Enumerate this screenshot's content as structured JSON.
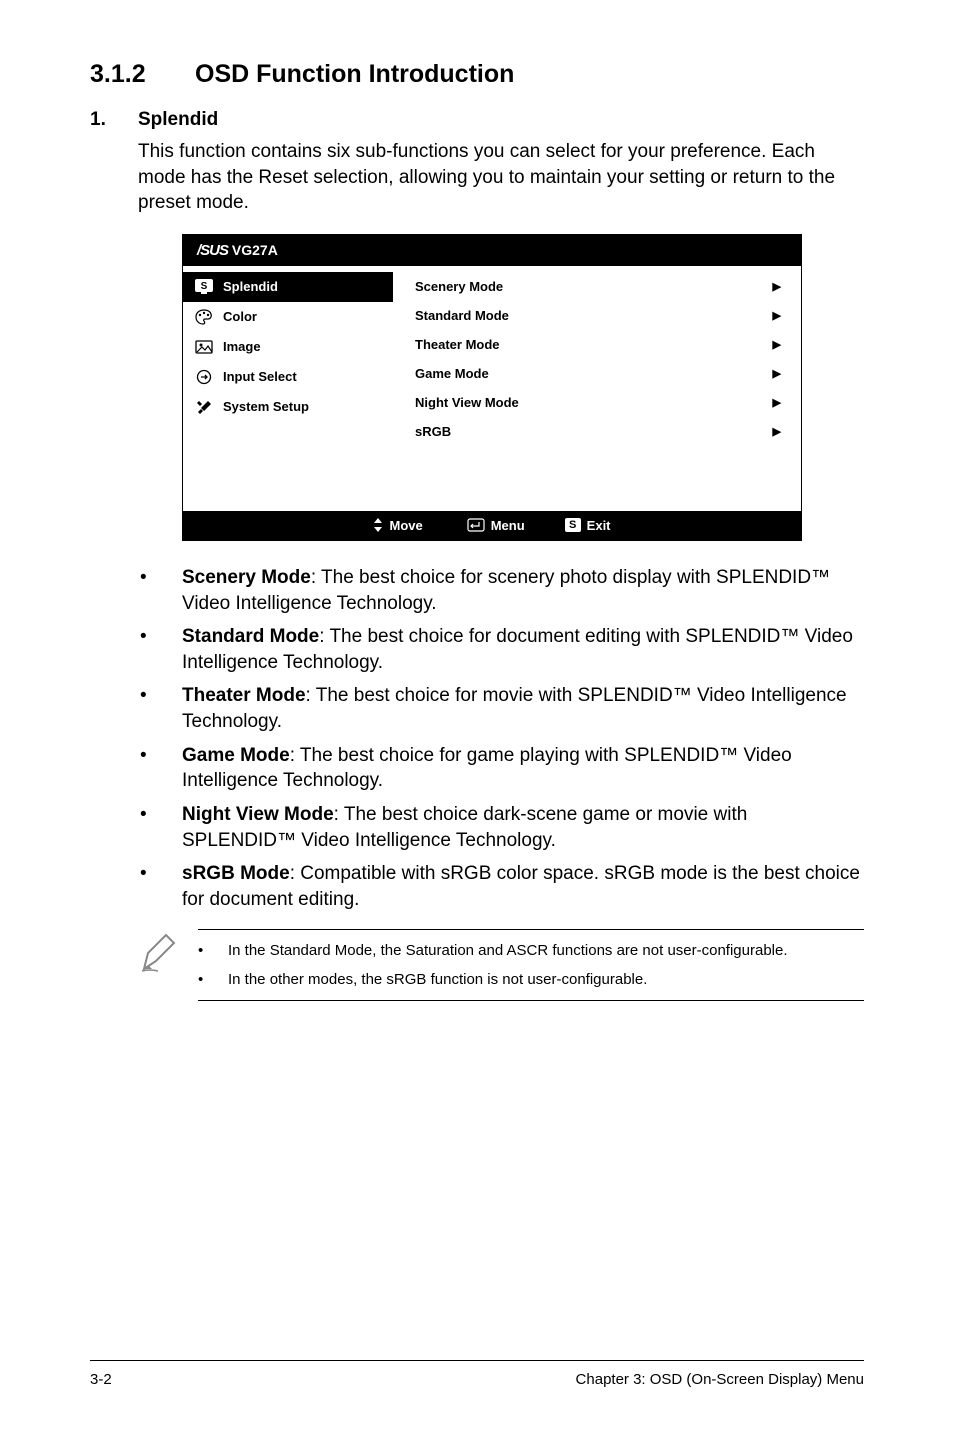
{
  "heading": {
    "num": "3.1.2",
    "title": "OSD Function Introduction"
  },
  "section": {
    "num": "1.",
    "title": "Splendid"
  },
  "intro": "This function contains six sub-functions you can select for your preference. Each mode has the Reset selection, allowing you to maintain your setting or return to the preset mode.",
  "osd": {
    "brand": "/SUS",
    "model": "VG27A",
    "left": [
      {
        "label": "Splendid",
        "icon": "s-monitor"
      },
      {
        "label": "Color",
        "icon": "palette"
      },
      {
        "label": "Image",
        "icon": "image"
      },
      {
        "label": "Input Select",
        "icon": "input"
      },
      {
        "label": "System Setup",
        "icon": "tools"
      }
    ],
    "right": [
      "Scenery Mode",
      "Standard Mode",
      "Theater Mode",
      "Game Mode",
      "Night View Mode",
      "sRGB"
    ],
    "footer": {
      "move": "Move",
      "menu": "Menu",
      "exit": "Exit"
    }
  },
  "bullets": [
    {
      "title": "Scenery Mode",
      "desc": ": The best choice for scenery photo display with SPLENDID™  Video Intelligence Technology."
    },
    {
      "title": "Standard Mode",
      "desc": ": The best choice for document editing with SPLENDID™ Video Intelligence Technology."
    },
    {
      "title": "Theater Mode",
      "desc": ": The best choice for movie with SPLENDID™ Video Intelligence Technology."
    },
    {
      "title": "Game Mode",
      "desc": ": The best choice for game playing with SPLENDID™ Video Intelligence Technology."
    },
    {
      "title": "Night View Mode",
      "desc": ": The best choice dark-scene game or movie with SPLENDID™ Video Intelligence Technology."
    },
    {
      "title": "sRGB Mode",
      "desc": ": Compatible with sRGB color space. sRGB mode is the best choice for document editing."
    }
  ],
  "notes": [
    "In the Standard Mode, the Saturation and ASCR functions are not user-configurable.",
    "In the other modes, the sRGB function is not user-configurable."
  ],
  "footer": {
    "page": "3-2",
    "chapter": "Chapter 3: OSD (On-Screen Display) Menu"
  }
}
